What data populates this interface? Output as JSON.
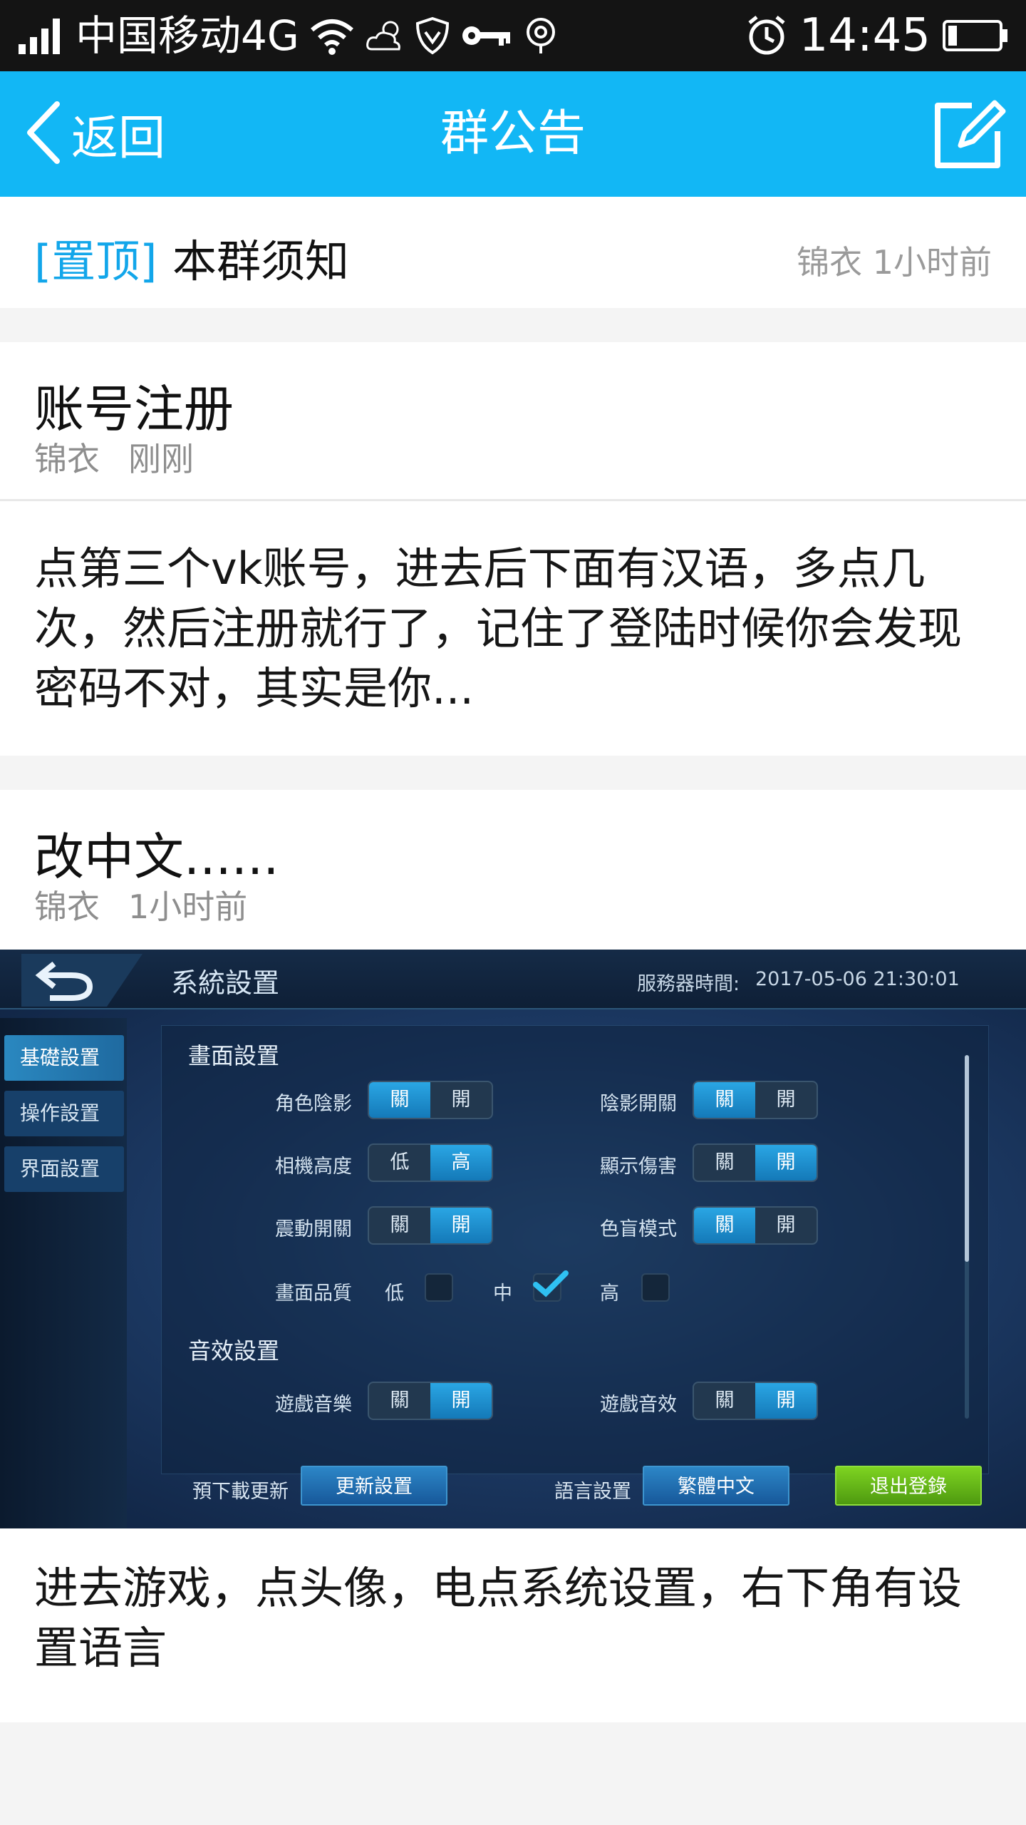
{
  "status_bar": {
    "carrier": "中国移动4G",
    "time": "14:45",
    "icons": [
      "signal-icon",
      "wifi-icon",
      "weather-icon",
      "shield-icon",
      "key-icon",
      "location-icon",
      "alarm-icon",
      "battery-icon"
    ]
  },
  "header": {
    "back_label": "返回",
    "title": "群公告",
    "edit_icon": "edit-icon"
  },
  "pinned": {
    "tag": "[置顶]",
    "title": "本群须知",
    "meta": "锦衣 1小时前"
  },
  "posts": [
    {
      "title": "账号注册",
      "author": "锦衣",
      "time": "刚刚",
      "body": "点第三个vk账号，进去后下面有汉语，多点几次，然后注册就行了，记住了登陆时候你会发现密码不对，其实是你..."
    },
    {
      "title": "改中文......",
      "author": "锦衣",
      "time": "1小时前",
      "body": "进去游戏，点头像，电点系统设置，右下角有设置语言",
      "image": {
        "title": "系統設置",
        "server_time_label": "服務器時間:",
        "server_time": "2017-05-06 21:30:01",
        "tabs": [
          "基礎設置",
          "操作設置",
          "界面設置"
        ],
        "section_display": "畫面設置",
        "section_audio": "音效設置",
        "settings": {
          "role_shadow": "角色陰影",
          "shadow_switch": "陰影開關",
          "camera_height": "相機高度",
          "show_damage": "顯示傷害",
          "vibration": "震動開關",
          "colorblind": "色盲模式",
          "quality": "畫面品質",
          "game_music": "遊戲音樂",
          "game_sound": "遊戲音效"
        },
        "options": {
          "off": "關",
          "on": "開",
          "low": "低",
          "high": "高",
          "mid": "中"
        },
        "footer": {
          "predownload_label": "預下載更新",
          "update_button": "更新設置",
          "language_label": "語言設置",
          "language_button": "繁體中文",
          "logout_button": "退出登錄"
        },
        "states": {
          "role_shadow": "off",
          "shadow_switch": "off",
          "camera_height": "high",
          "show_damage": "on",
          "vibration": "on",
          "colorblind": "off",
          "quality": "mid",
          "game_music": "on",
          "game_sound": "on"
        }
      }
    }
  ],
  "colors": {
    "header_bg": "#12b7f5",
    "pin_tag": "#12a6ea",
    "status_bar_bg": "#141414"
  }
}
